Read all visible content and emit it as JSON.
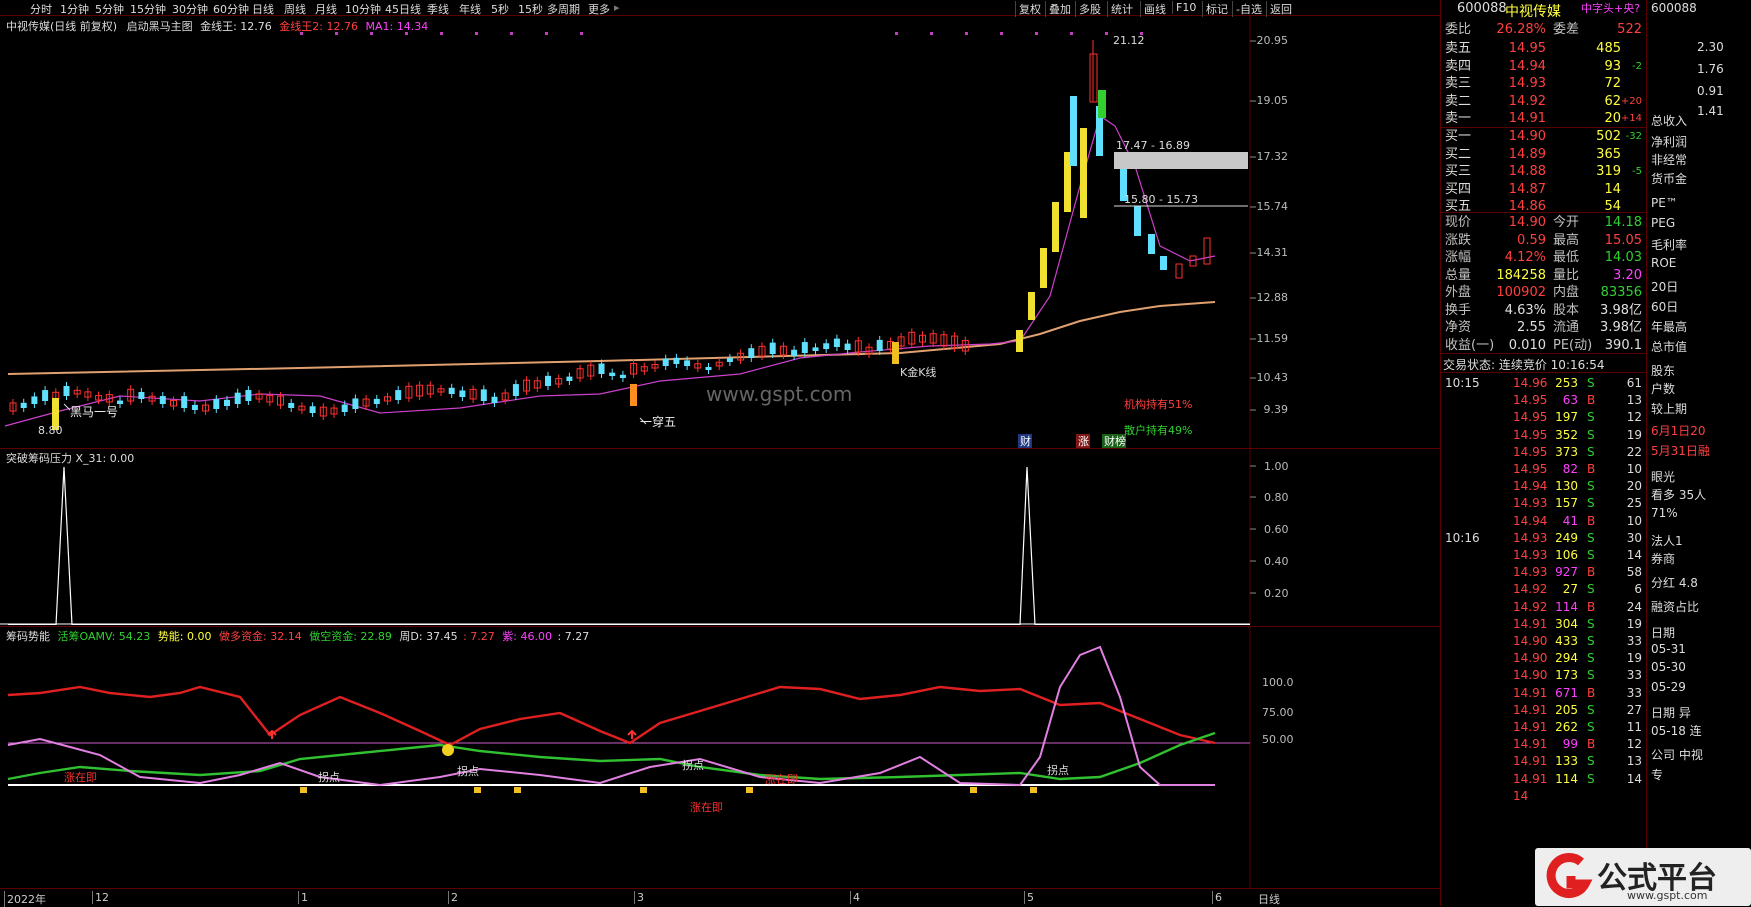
{
  "toolbar": {
    "periods": [
      "分时",
      "1分钟",
      "5分钟",
      "15分钟",
      "30分钟",
      "60分钟",
      "日线",
      "周线",
      "月线",
      "10分钟",
      "45日线",
      "季线",
      "年线",
      "5秒",
      "15秒",
      "多周期",
      "更多"
    ],
    "right_buttons": [
      "复权",
      "叠加",
      "多股",
      "统计",
      "画线",
      "F10",
      "标记",
      "-自选",
      "返回"
    ]
  },
  "main_header": {
    "stock": "中视传媒(日线 前复权)",
    "formula": "启动黑马主图",
    "gold_label": "金线王: 12.76",
    "gold2_label": "金线王2: 12.76",
    "ma_label": "MA1: 14.34"
  },
  "main_axis": [
    "20.95",
    "19.05",
    "17.32",
    "15.74",
    "14.31",
    "12.88",
    "11.59",
    "10.43",
    "9.39"
  ],
  "annotations": {
    "hi": "21.12",
    "lo": "8.80",
    "band1": "17.47 - 16.89",
    "band2": "15.80 - 15.73",
    "heima": "黑马一号",
    "yichuan": "一穿五",
    "kjx": "K金K线",
    "inst": "机构持有51%",
    "retail": "散户持有49%",
    "cai": "财",
    "zhang": "涨",
    "caibao": "财榜",
    "watermark": "www.gspt.com"
  },
  "ind1": {
    "header": "突破筹码压力  X_31: 0.00",
    "axis": [
      "1.00",
      "0.80",
      "0.60",
      "0.40",
      "0.20"
    ]
  },
  "ind2": {
    "title": "筹码势能",
    "huo": "活筹OAMV: 54.23",
    "shi": "势能: 0.00",
    "duo": "做多资金: 32.14",
    "kong": "做空资金: 22.89",
    "zhou": "周D: 37.45",
    "v1": ": 7.27",
    "zi": "紫: 46.00",
    "v2": ": 7.27",
    "axis": [
      "100.0",
      "75.00",
      "50.00"
    ],
    "labels": [
      "涨在即",
      "拐点",
      "拐点",
      "拐点",
      "涨在即",
      "涨在即",
      "拐点"
    ]
  },
  "bottom": {
    "dates": [
      "2022年",
      "12",
      "1",
      "2",
      "3",
      "4",
      "5",
      "6"
    ],
    "period": "日线"
  },
  "quote": {
    "code": "600088",
    "name": "中视传媒",
    "tag": "中字头+央?",
    "weibi_label": "委比",
    "weibi": "26.28%",
    "weicha_label": "委差",
    "weicha": "522",
    "asks": [
      {
        "l": "卖五",
        "p": "14.95",
        "v": "485",
        "d": ""
      },
      {
        "l": "卖四",
        "p": "14.94",
        "v": "93",
        "d": "-2"
      },
      {
        "l": "卖三",
        "p": "14.93",
        "v": "72",
        "d": ""
      },
      {
        "l": "卖二",
        "p": "14.92",
        "v": "62",
        "d": "+20"
      },
      {
        "l": "卖一",
        "p": "14.91",
        "v": "20",
        "d": "+14"
      }
    ],
    "bids": [
      {
        "l": "买一",
        "p": "14.90",
        "v": "502",
        "d": "-32"
      },
      {
        "l": "买二",
        "p": "14.89",
        "v": "365",
        "d": ""
      },
      {
        "l": "买三",
        "p": "14.88",
        "v": "319",
        "d": "-5"
      },
      {
        "l": "买四",
        "p": "14.87",
        "v": "14",
        "d": ""
      },
      {
        "l": "买五",
        "p": "14.86",
        "v": "54",
        "d": ""
      }
    ],
    "stats": [
      {
        "a": "现价",
        "b": "14.90",
        "c": "今开",
        "d": "14.18",
        "bc": "red",
        "dc": "grn"
      },
      {
        "a": "涨跌",
        "b": "0.59",
        "c": "最高",
        "d": "15.05",
        "bc": "red",
        "dc": "red"
      },
      {
        "a": "涨幅",
        "b": "4.12%",
        "c": "最低",
        "d": "14.03",
        "bc": "red",
        "dc": "grn"
      },
      {
        "a": "总量",
        "b": "184258",
        "c": "量比",
        "d": "3.20",
        "bc": "yel",
        "dc": "mag"
      },
      {
        "a": "外盘",
        "b": "100902",
        "c": "内盘",
        "d": "83356",
        "bc": "red",
        "dc": "grn"
      },
      {
        "a": "换手",
        "b": "4.63%",
        "c": "股本",
        "d": "3.98亿",
        "bc": "wht",
        "dc": "wht"
      },
      {
        "a": "净资",
        "b": "2.55",
        "c": "流通",
        "d": "3.98亿",
        "bc": "wht",
        "dc": "wht"
      },
      {
        "a": "收益(一)",
        "b": "0.010",
        "c": "PE(动)",
        "d": "390.1",
        "bc": "wht",
        "dc": "wht"
      }
    ],
    "status": "交易状态: 连续竞价 10:16:54",
    "ticks": [
      {
        "t": "10:15",
        "p": "14.96",
        "v": "253",
        "s": "S",
        "n": "61"
      },
      {
        "t": "",
        "p": "14.95",
        "v": "63",
        "s": "B",
        "n": "13"
      },
      {
        "t": "",
        "p": "14.95",
        "v": "197",
        "s": "S",
        "n": "12"
      },
      {
        "t": "",
        "p": "14.95",
        "v": "352",
        "s": "S",
        "n": "19"
      },
      {
        "t": "",
        "p": "14.95",
        "v": "373",
        "s": "S",
        "n": "22"
      },
      {
        "t": "",
        "p": "14.95",
        "v": "82",
        "s": "B",
        "n": "10"
      },
      {
        "t": "",
        "p": "14.94",
        "v": "130",
        "s": "S",
        "n": "20"
      },
      {
        "t": "",
        "p": "14.93",
        "v": "157",
        "s": "S",
        "n": "25"
      },
      {
        "t": "",
        "p": "14.94",
        "v": "41",
        "s": "B",
        "n": "10"
      },
      {
        "t": "10:16",
        "p": "14.93",
        "v": "249",
        "s": "S",
        "n": "30"
      },
      {
        "t": "",
        "p": "14.93",
        "v": "106",
        "s": "S",
        "n": "14"
      },
      {
        "t": "",
        "p": "14.93",
        "v": "927",
        "s": "B",
        "n": "58"
      },
      {
        "t": "",
        "p": "14.92",
        "v": "27",
        "s": "S",
        "n": "6"
      },
      {
        "t": "",
        "p": "14.92",
        "v": "114",
        "s": "B",
        "n": "24"
      },
      {
        "t": "",
        "p": "14.91",
        "v": "304",
        "s": "S",
        "n": "19"
      },
      {
        "t": "",
        "p": "14.90",
        "v": "433",
        "s": "S",
        "n": "33"
      },
      {
        "t": "",
        "p": "14.90",
        "v": "294",
        "s": "S",
        "n": "19"
      },
      {
        "t": "",
        "p": "14.90",
        "v": "173",
        "s": "S",
        "n": "33"
      },
      {
        "t": "",
        "p": "14.91",
        "v": "671",
        "s": "B",
        "n": "33"
      },
      {
        "t": "",
        "p": "14.91",
        "v": "205",
        "s": "S",
        "n": "27"
      },
      {
        "t": "",
        "p": "14.91",
        "v": "262",
        "s": "S",
        "n": "11"
      },
      {
        "t": "",
        "p": "14.91",
        "v": "99",
        "s": "B",
        "n": "12"
      },
      {
        "t": "",
        "p": "14.91",
        "v": "133",
        "s": "S",
        "n": "13"
      },
      {
        "t": "",
        "p": "14.91",
        "v": "114",
        "s": "S",
        "n": "14"
      },
      {
        "t": "",
        "p": "14",
        "v": "",
        "s": "",
        "n": ""
      }
    ]
  },
  "farright": {
    "code": "600088",
    "nums": [
      "2.30",
      "1.76",
      "0.91",
      "1.41"
    ],
    "items": [
      "总收入",
      "净利润",
      "非经常",
      "货币金",
      "PE™",
      "PEG",
      "毛利率",
      "ROE",
      "20日",
      "60日",
      "年最高",
      "总市值",
      "股东",
      "户数",
      "较上期",
      "6月1日20",
      "5月31日融",
      "眼光",
      "看多 35人",
      "71%",
      "法人1",
      "券商",
      "分红 4.8",
      "融资占比",
      "日期",
      "05-31",
      "05-30",
      "05-29",
      "日期 异",
      "05-18 连",
      "公司 中视",
      "专"
    ]
  },
  "logo": {
    "text": "公式平台",
    "url": "www.gspt.com"
  }
}
